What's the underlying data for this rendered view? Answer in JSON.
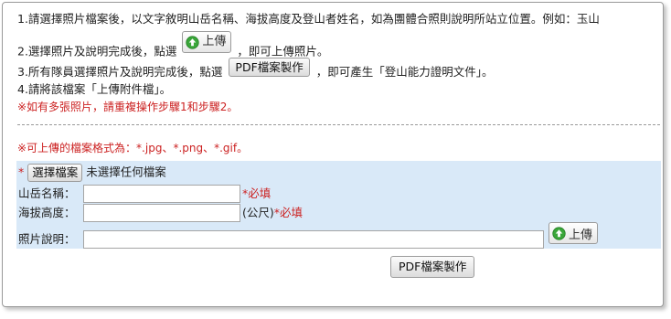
{
  "instructions": {
    "line1": "1.請選擇照片檔案後，以文字敘明山岳名稱、海拔高度及登山者姓名，如為團體合照則說明所站立位置。例如：玉山",
    "line2_before": "2.選擇照片及說明完成後，點選",
    "line2_after": "，即可上傳照片。",
    "line3_before": "3.所有隊員選擇照片及說明完成後，點選",
    "line3_after": "，即可產生「登山能力證明文件」。",
    "line4": "4.請將該檔案「上傳附件檔」。",
    "note_multi": "※如有多張照片，請重複操作步驟1和步驟2。",
    "upload_button_label": "上傳",
    "pdf_button_label": "PDF檔案製作"
  },
  "format_note": "※可上傳的檔案格式為：*.jpg、*.png、*.gif。",
  "form": {
    "file": {
      "required_mark": "*",
      "choose_button": "選擇檔案",
      "status": "未選擇任何檔案"
    },
    "mountain": {
      "label": "山岳名稱：",
      "value": "",
      "required": "*必填"
    },
    "altitude": {
      "label": "海拔高度：",
      "value": "",
      "unit": "(公尺)",
      "required": "*必填"
    },
    "description": {
      "label": "照片說明：",
      "value": ""
    },
    "upload_button": "上傳",
    "pdf_button": "PDF檔案製作"
  },
  "colors": {
    "required_red": "#cc2222",
    "form_background": "#d9e9f8",
    "upload_icon_green": "#3aa63a"
  },
  "icons": {
    "upload": "upload-arrow-icon"
  }
}
